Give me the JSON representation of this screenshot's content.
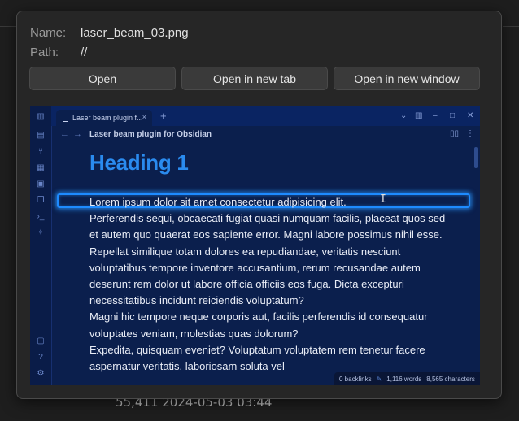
{
  "background": {
    "partial_row_text": "55,411     2024-05-03 03:44"
  },
  "file_info": {
    "name_label": "Name:",
    "name_value": "laser_beam_03.png",
    "path_label": "Path:",
    "path_value": "//"
  },
  "actions": {
    "open": "Open",
    "open_new_tab": "Open in new tab",
    "open_new_window": "Open in new window"
  },
  "preview": {
    "tab_title": "Laser beam plugin f...",
    "tab_close": "×",
    "new_tab": "+",
    "note_title": "Laser beam plugin for Obsidian",
    "heading": "Heading 1",
    "paragraphs": [
      "Lorem ipsum dolor sit amet consectetur adipisicing elit.",
      "Perferendis sequi, obcaecati fugiat quasi numquam facilis, placeat quos sed et autem quo quaerat eos sapiente error. Magni labore possimus nihil esse.",
      "Repellat similique totam dolores ea repudiandae, veritatis nesciunt voluptatibus tempore inventore accusantium, rerum recusandae autem deserunt rem dolor ut labore officia officiis eos fuga. Dicta excepturi necessitatibus incidunt reiciendis voluptatum?",
      "Magni hic tempore neque corporis aut, facilis perferendis id consequatur voluptates veniam, molestias quas dolorum?",
      "Expedita, quisquam eveniet? Voluptatum voluptatem rem tenetur facere aspernatur veritatis, laboriosam soluta vel"
    ],
    "status": {
      "backlinks": "0 backlinks",
      "words": "1,116 words",
      "characters": "8,565 characters"
    },
    "colors": {
      "background": "#0b1f4d",
      "heading": "#2a8bef",
      "beam": "#1e8bff"
    }
  }
}
